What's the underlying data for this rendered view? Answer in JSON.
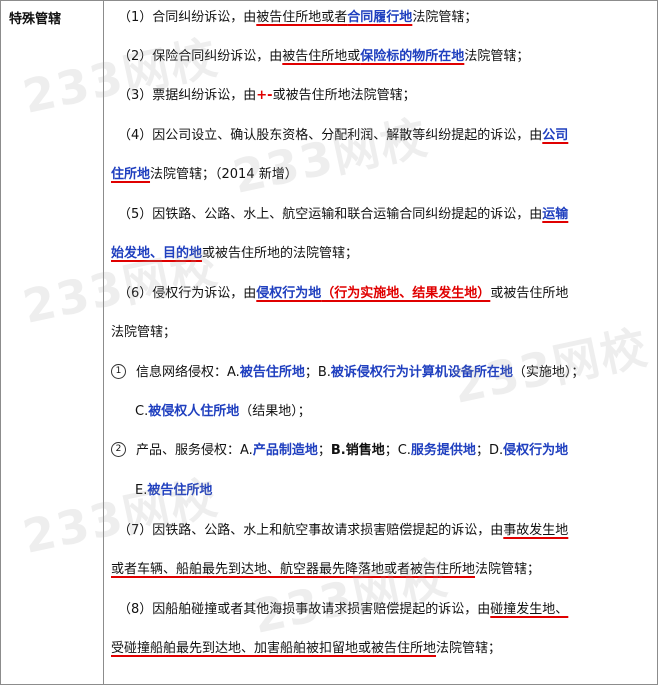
{
  "header": {
    "label": "特殊管辖"
  },
  "watermark": "233网校",
  "lines": [
    [
      {
        "t": "（1）合同纠纷诉讼，由"
      },
      {
        "t": "被告住所地或者",
        "u": 1
      },
      {
        "t": "合同履行地",
        "c": "b",
        "u": 1
      },
      {
        "t": "法院管辖；"
      }
    ],
    [
      {
        "t": "（2）保险合同纠纷诉讼，由"
      },
      {
        "t": "被告住所地或",
        "u": 1
      },
      {
        "t": "保险标的物所在地",
        "c": "b",
        "u": 1
      },
      {
        "t": "法院管辖；"
      }
    ],
    [
      {
        "t": "（3）票据纠纷诉讼，由"
      },
      {
        "t": "+-",
        "c": "r"
      },
      {
        "t": "或被告住所地法院管辖；"
      }
    ],
    [
      {
        "t": "（4）因公司设立、确认股东资格、分配利润、解散等纠纷提起的诉讼，由"
      },
      {
        "t": "公司",
        "c": "b",
        "u": 1
      }
    ],
    [
      {
        "t": "住所地",
        "c": "b",
        "u": 1
      },
      {
        "t": "法院管辖；（2014 新增）"
      }
    ],
    [
      {
        "t": "（5）因铁路、公路、水上、航空运输和联合运输合同纠纷提起的诉讼，由"
      },
      {
        "t": "运输",
        "c": "b",
        "u": 1
      }
    ],
    [
      {
        "t": "始发地、目的地",
        "c": "b",
        "u": 1
      },
      {
        "t": "或被告住所地的法院管辖；"
      }
    ],
    [
      {
        "t": "（6）侵权行为诉讼，由"
      },
      {
        "t": "侵权行为地",
        "c": "b",
        "u": 1
      },
      {
        "t": "（行为实施地、结果发生地）",
        "c": "r",
        "u": 1
      },
      {
        "t": "或被告住所地"
      }
    ],
    [
      {
        "t": "法院管辖；"
      }
    ],
    [
      {
        "t": "信息网络侵权：A."
      },
      {
        "t": "被告住所地",
        "c": "b"
      },
      {
        "t": "；B."
      },
      {
        "t": "被诉侵权行为计算机设备所在地",
        "c": "b"
      },
      {
        "t": "（实施地）；"
      }
    ],
    [
      {
        "t": "C."
      },
      {
        "t": "被侵权人住所地",
        "c": "b"
      },
      {
        "t": "（结果地）；"
      }
    ],
    [
      {
        "t": "产品、服务侵权：A."
      },
      {
        "t": "产品制造地",
        "c": "b"
      },
      {
        "t": "；"
      },
      {
        "t": "B.销售地",
        "c": "k"
      },
      {
        "t": "；C."
      },
      {
        "t": "服务提供地",
        "c": "b"
      },
      {
        "t": "；D."
      },
      {
        "t": "侵权行为地",
        "c": "b"
      }
    ],
    [
      {
        "t": "E."
      },
      {
        "t": "被告住所地",
        "c": "b"
      }
    ],
    [
      {
        "t": "（7）因铁路、公路、水上和航空事故请求损害赔偿提起的诉讼，由"
      },
      {
        "t": "事故发生地",
        "u": 1
      }
    ],
    [
      {
        "t": "或者车辆、船舶最先到达地、航空器最先降落地或者被告住所地",
        "u": 1
      },
      {
        "t": "法院管辖；"
      }
    ],
    [
      {
        "t": "（8）因船舶碰撞或者其他海损事故请求损害赔偿提起的诉讼，由"
      },
      {
        "t": "碰撞发生地、",
        "u": 1
      }
    ],
    [
      {
        "t": "受碰撞船舶最先到达地、加害船舶被扣留地或被告住所地",
        "u": 1
      },
      {
        "t": "法院管辖；"
      }
    ]
  ],
  "markers": [
    "1",
    "2"
  ]
}
